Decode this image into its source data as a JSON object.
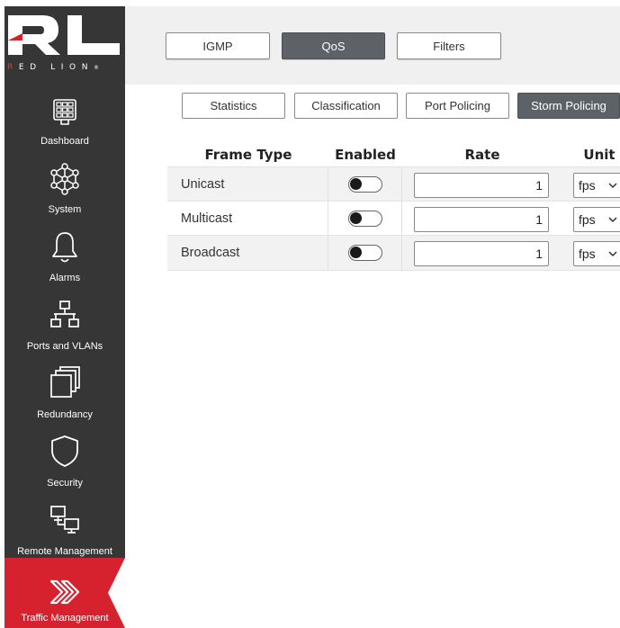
{
  "brand": {
    "logo_sub_red": "R",
    "logo_sub_rest": "ED LION",
    "logo_mark": "®"
  },
  "sidebar": {
    "items": [
      {
        "label": "Dashboard",
        "icon": "dashboard-icon"
      },
      {
        "label": "System",
        "icon": "system-network-icon"
      },
      {
        "label": "Alarms",
        "icon": "bell-icon"
      },
      {
        "label": "Ports and VLANs",
        "icon": "ports-vlans-icon"
      },
      {
        "label": "Redundancy",
        "icon": "redundancy-icon"
      },
      {
        "label": "Security",
        "icon": "shield-icon"
      },
      {
        "label": "Remote Management",
        "icon": "remote-management-icon"
      },
      {
        "label": "Traffic Management",
        "icon": "traffic-chevrons-icon",
        "active": true
      }
    ]
  },
  "tabs": [
    {
      "label": "IGMP",
      "selected": false
    },
    {
      "label": "QoS",
      "selected": true
    },
    {
      "label": "Filters",
      "selected": false
    }
  ],
  "subtabs": [
    {
      "label": "Statistics",
      "selected": false
    },
    {
      "label": "Classification",
      "selected": false
    },
    {
      "label": "Port Policing",
      "selected": false
    },
    {
      "label": "Storm Policing",
      "selected": true
    }
  ],
  "table": {
    "headers": {
      "frame_type": "Frame Type",
      "enabled": "Enabled",
      "rate": "Rate",
      "unit": "Unit"
    },
    "rows": [
      {
        "frame_type": "Unicast",
        "enabled": false,
        "rate": "1",
        "unit": "fps"
      },
      {
        "frame_type": "Multicast",
        "enabled": false,
        "rate": "1",
        "unit": "fps"
      },
      {
        "frame_type": "Broadcast",
        "enabled": false,
        "rate": "1",
        "unit": "fps"
      }
    ]
  },
  "colors": {
    "sidebar_bg": "#363636",
    "active_red": "#d6212e",
    "selected_tab": "#5d6269"
  }
}
